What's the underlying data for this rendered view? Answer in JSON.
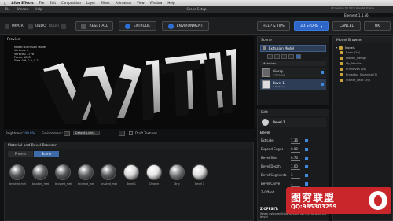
{
  "mac_menu": [
    "After Effects",
    "File",
    "Edit",
    "Composition",
    "Layer",
    "Effect",
    "Animation",
    "View",
    "Window",
    "Help"
  ],
  "window": {
    "title": "Scene Setup",
    "menu": [
      "File",
      "Window",
      "Help"
    ],
    "sys_info_line1": "ATI Radeon HD 5870 OpenGL Engine",
    "sys_info_line2": "",
    "element_label": "Element 1.4.56"
  },
  "toolbar": {
    "import_label": "IMPORT",
    "undo_label": "UNDO",
    "redo_label": "REDO",
    "reset_label": "RESET ALL",
    "extrude_label": "EXTRUDE",
    "environment_label": "ENVIRONMENT",
    "help_label": "HELP & TIPS",
    "store_label": "3D STORE",
    "cancel_label": "CANCEL",
    "ok_label": "OK"
  },
  "preview": {
    "title": "Preview",
    "info_lines": [
      "Model: Extrusion Model",
      "Vertices: 0",
      "Vertices: 3776",
      "Faces: 1835",
      "Size: 0.9, 0.8, 0.2"
    ],
    "brightness_label": "Brightness:",
    "brightness_value": "100.0%",
    "environment_label": "Environment:",
    "lights_value": "Default Lights",
    "draft_label": "Draft Textures"
  },
  "material_browser": {
    "title": "Material and Bevel Browser",
    "tabs": [
      "Presets",
      "Scene"
    ],
    "materials": [
      "brushed_met",
      "brushed_met",
      "brushed_met",
      "brushed_met",
      "brushed_met",
      "Bevel 1",
      "Chrome",
      "Dirty",
      "Bevel 1"
    ],
    "ball_colors": [
      "#5a5c60",
      "#5f6165",
      "#56585c",
      "#646669",
      "#5b5d61",
      "#d8d8d8",
      "#e6e6e6",
      "#7c7e80",
      "#dcdcdc"
    ]
  },
  "scene": {
    "title": "Scene",
    "model_name": "Extrusion Model",
    "materials_header": "Materials",
    "items": [
      {
        "name": "Glossy",
        "sub": "1 Textures"
      },
      {
        "name": "Bevel 1",
        "sub": "1 Textures"
      }
    ]
  },
  "edit": {
    "title": "Edit",
    "material_name": "Bevel 1",
    "section": "Bevel",
    "params": [
      {
        "label": "Extrude",
        "value": "1.36"
      },
      {
        "label": "Expand Edges",
        "value": "0.00"
      },
      {
        "label": "Bevel Size",
        "value": "0.76"
      },
      {
        "label": "Bevel Depth",
        "value": "1.00"
      },
      {
        "label": "Bevel Segments",
        "value": "3"
      },
      {
        "label": "Bevel Curve",
        "value": "1"
      },
      {
        "label": "Z-Offset",
        "value": "0"
      }
    ],
    "z_offset_heading": "Z-OFFSET:",
    "z_offset_text": "When using multiple Bevels, set this to slide the bevel"
  },
  "model_browser": {
    "title": "Model Browser",
    "root": "Models",
    "folders": [
      "Basic (26)",
      "Motion_Design",
      "My_Models",
      "Primitives (36)",
      "Projector_Separate (5)",
      "Starter_Pack (39)"
    ]
  },
  "watermark": {
    "text_cn": "图穷联盟",
    "qq": "QQ:985303259"
  },
  "colors": {
    "accent": "#2d66c8",
    "panel": "#1a1b1c",
    "watermark": "#c8262a"
  }
}
